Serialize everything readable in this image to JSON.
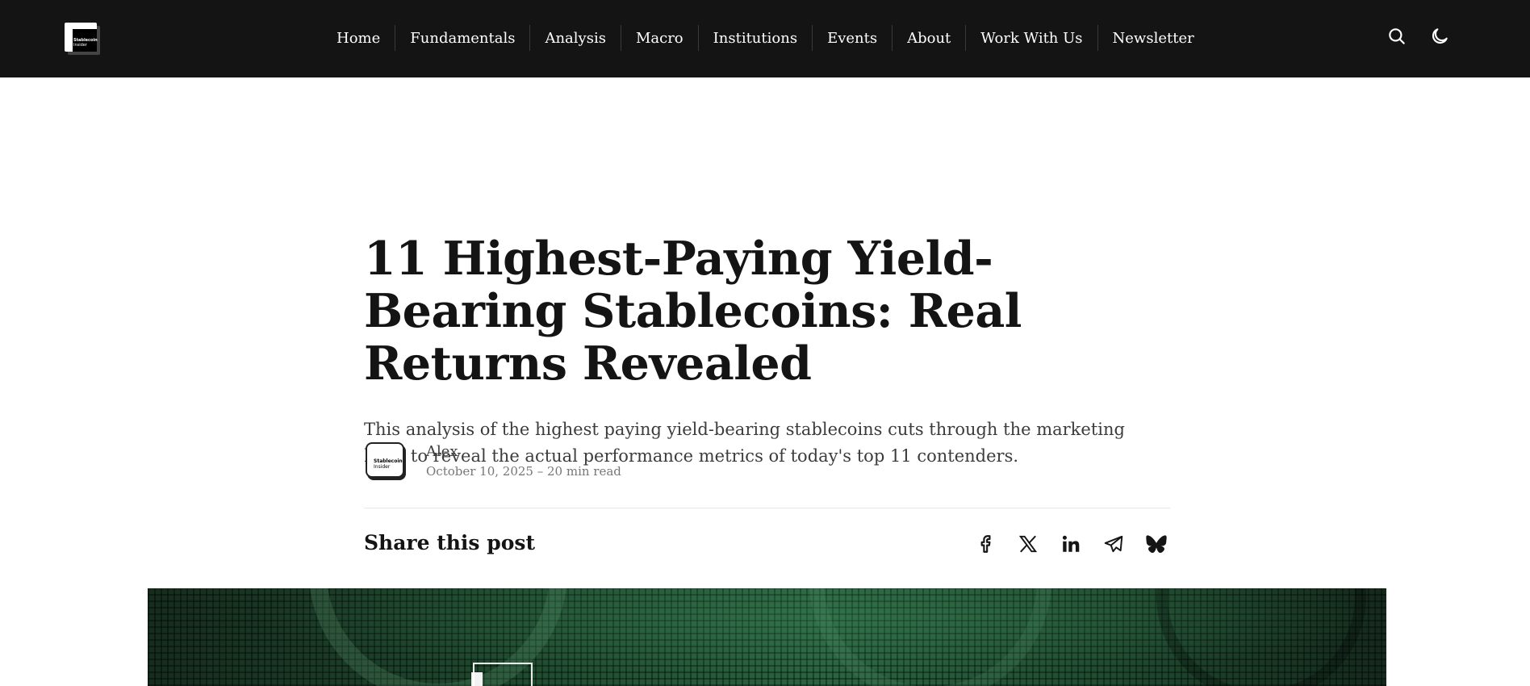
{
  "header": {
    "logo": {
      "line1": "Stablecoin",
      "line2": "Insider"
    },
    "nav": [
      "Home",
      "Fundamentals",
      "Analysis",
      "Macro",
      "Institutions",
      "Events",
      "About",
      "Work With Us",
      "Newsletter"
    ],
    "icons": [
      "search-icon",
      "moon-icon"
    ]
  },
  "article": {
    "title": "11 Highest-Paying Yield-Bearing Stablecoins: Real Returns Revealed",
    "subtitle": "This analysis of the highest paying yield-bearing stablecoins cuts through the marketing hype to reveal the actual performance metrics of today's top 11 contenders.",
    "author": {
      "name": "Alex",
      "meta": "October 10, 2025 – 20 min read",
      "avatar": {
        "line1": "Stablecoin",
        "line2": "Insider"
      }
    },
    "share": {
      "label": "Share this post",
      "icons": [
        "facebook-icon",
        "x-icon",
        "linkedin-icon",
        "telegram-icon",
        "bluesky-icon"
      ]
    }
  },
  "colors": {
    "header_bg": "#141414",
    "header_text": "#ffffff",
    "title_text": "#141414",
    "subtitle_text": "#3c3c3c",
    "meta_text": "#777777",
    "hero_green": "#2a6440"
  }
}
